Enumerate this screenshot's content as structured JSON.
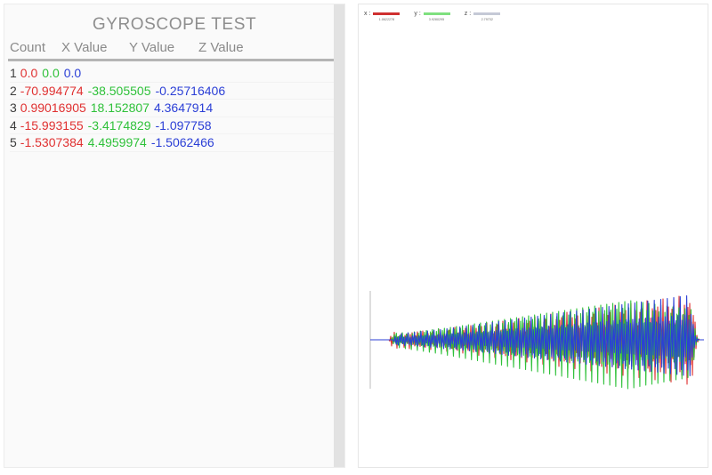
{
  "panel": {
    "title": "GYROSCOPE TEST",
    "columns": [
      "Count",
      "X Value",
      "Y Value",
      "Z Value"
    ],
    "rows": [
      {
        "count": "1",
        "x": "0.0",
        "y": "0.0",
        "z": "0.0"
      },
      {
        "count": "2",
        "x": "-70.994774",
        "y": "-38.505505",
        "z": "-0.25716406"
      },
      {
        "count": "3",
        "x": "0.99016905",
        "y": "18.152807",
        "z": "4.3647914"
      },
      {
        "count": "4",
        "x": "-15.993155",
        "y": "-3.4174829",
        "z": "-1.097758"
      },
      {
        "count": "5",
        "x": "-1.5307384",
        "y": "4.4959974",
        "z": "-1.5062466"
      }
    ]
  },
  "colors": {
    "x_series": "#e03131",
    "y_series": "#2fc13a",
    "z_series": "#2b3fd6",
    "title_text": "#8e8e8e",
    "header_text": "#8a8a8a",
    "axis_line": "#c8c8c8",
    "panel_background": "#fafafa",
    "graph_background": "#ffffff"
  },
  "graph": {
    "legend": [
      {
        "key": "x :",
        "value": "1.0622278",
        "swatch": "#cf3030"
      },
      {
        "key": "y :",
        "value": "3.9280295",
        "swatch": "#7fe07f"
      },
      {
        "key": "z :",
        "value": "2.79732",
        "swatch": "#c5c9d6"
      }
    ]
  },
  "chart_data": {
    "type": "line",
    "title": "",
    "xlabel": "",
    "ylabel": "",
    "grid": false,
    "legend_position": "top-left",
    "baseline_y": 0,
    "x_range": [
      0,
      370
    ],
    "y_range": [
      -110,
      110
    ],
    "series": [
      {
        "name": "x",
        "color": "#e03131",
        "values": [
          0,
          0,
          0,
          0,
          0,
          0,
          0,
          0,
          0,
          0,
          0,
          0,
          0,
          0,
          0,
          0,
          0,
          0,
          0,
          0,
          0,
          0,
          -3,
          8,
          -14,
          6,
          -9,
          17,
          -6,
          11,
          -19,
          7,
          -12,
          9,
          -5,
          14,
          -8,
          6,
          -17,
          10,
          -7,
          13,
          -9,
          5,
          -20,
          12,
          -8,
          16,
          -11,
          7,
          -14,
          9,
          -6,
          18,
          -12,
          8,
          -15,
          11,
          -9,
          20,
          -13,
          7,
          -17,
          12,
          -8,
          14,
          -10,
          6,
          -22,
          15,
          -9,
          18,
          -12,
          8,
          -16,
          11,
          -7,
          24,
          -17,
          10,
          -20,
          13,
          -9,
          18,
          -12,
          8,
          -26,
          19,
          -11,
          22,
          -14,
          10,
          -20,
          14,
          -9,
          28,
          -20,
          12,
          -24,
          16,
          -11,
          22,
          -15,
          10,
          -30,
          21,
          -13,
          26,
          -17,
          12,
          -24,
          16,
          -11,
          32,
          -23,
          14,
          -28,
          18,
          -13,
          26,
          -18,
          12,
          -35,
          25,
          -15,
          30,
          -20,
          14,
          -28,
          19,
          -13,
          38,
          -27,
          17,
          -32,
          21,
          -15,
          30,
          -20,
          14,
          -40,
          29,
          -18,
          34,
          -23,
          16,
          -32,
          22,
          -15,
          42,
          -31,
          19,
          -36,
          24,
          -17,
          34,
          -23,
          16,
          -45,
          33,
          -20,
          38,
          -26,
          18,
          -36,
          25,
          -17,
          48,
          -35,
          22,
          -40,
          27,
          -19,
          38,
          -26,
          18,
          -50,
          37,
          -23,
          42,
          -29,
          20,
          -40,
          28,
          -19,
          52,
          -38,
          24,
          -44,
          30,
          -21,
          42,
          -29,
          20,
          -55,
          40,
          -25,
          46,
          -31,
          22,
          -44,
          30,
          -21,
          58,
          -42,
          26,
          -48,
          33,
          -23,
          46,
          -32,
          22,
          -60,
          44,
          -27,
          50,
          -34,
          24,
          -48,
          33,
          -23,
          62,
          -46,
          28,
          -52,
          36,
          -25,
          50,
          -34,
          24,
          -65,
          47,
          -29,
          54,
          -37,
          26,
          -52,
          36,
          -25,
          68,
          -50,
          31,
          -56,
          38,
          -27,
          54,
          -37,
          26,
          -70,
          51,
          -32,
          58,
          -40,
          28,
          -56,
          38,
          -27,
          72,
          -53,
          33,
          -60,
          41,
          -29,
          58,
          -40,
          28,
          -75,
          55,
          -34,
          62,
          -42,
          30,
          -60,
          41,
          -29,
          78,
          -57,
          35,
          -64,
          44,
          -31,
          62,
          -43,
          30,
          -80,
          58,
          -36,
          66,
          -45,
          32,
          -64,
          44,
          -31,
          82,
          -60,
          37,
          -68,
          47,
          -33,
          66,
          -45,
          32,
          -85,
          62,
          -38,
          70,
          -48,
          34,
          -68,
          47,
          -33,
          88,
          -64,
          40,
          -72,
          49,
          -35,
          70,
          -48,
          34,
          -90,
          66,
          -41,
          74,
          -51,
          36,
          -72,
          50,
          -35,
          92,
          -67,
          42,
          -76,
          52,
          -37,
          74,
          -51,
          36,
          -95,
          69,
          -43,
          78,
          -53,
          38,
          -76,
          52,
          -37,
          98,
          -72,
          44,
          -80,
          55,
          -39,
          78,
          -54,
          38,
          -100,
          73,
          -45,
          82,
          -56,
          40,
          -80,
          55,
          -39,
          40,
          -20,
          10,
          -5,
          2,
          0,
          0,
          0,
          0,
          0,
          0
        ]
      },
      {
        "name": "y",
        "color": "#2fc13a",
        "values": [
          0,
          0,
          0,
          0,
          0,
          0,
          0,
          0,
          0,
          0,
          0,
          0,
          0,
          0,
          0,
          0,
          0,
          0,
          0,
          0,
          0,
          0,
          5,
          -9,
          12,
          -6,
          15,
          -10,
          7,
          -18,
          11,
          -7,
          16,
          -9,
          6,
          -20,
          13,
          -8,
          15,
          -11,
          7,
          -22,
          14,
          -9,
          18,
          -12,
          8,
          -24,
          15,
          -10,
          20,
          -13,
          9,
          -26,
          17,
          -11,
          21,
          -14,
          9,
          -28,
          18,
          -12,
          23,
          -15,
          10,
          -30,
          19,
          -13,
          25,
          -16,
          11,
          -32,
          21,
          -14,
          26,
          -17,
          12,
          -35,
          22,
          -15,
          28,
          -19,
          13,
          -37,
          24,
          -16,
          30,
          -20,
          14,
          -40,
          26,
          -17,
          32,
          -21,
          15,
          -42,
          27,
          -18,
          34,
          -23,
          15,
          -45,
          29,
          -19,
          36,
          -24,
          16,
          -47,
          31,
          -20,
          38,
          -26,
          17,
          -50,
          32,
          -21,
          40,
          -27,
          18,
          -52,
          34,
          -22,
          42,
          -28,
          19,
          -55,
          36,
          -24,
          44,
          -30,
          20,
          -57,
          37,
          -25,
          46,
          -31,
          21,
          -60,
          39,
          -26,
          48,
          -33,
          22,
          -62,
          41,
          -27,
          50,
          -34,
          23,
          -65,
          42,
          -28,
          52,
          -35,
          24,
          -67,
          44,
          -29,
          54,
          -37,
          25,
          -70,
          46,
          -30,
          56,
          -38,
          26,
          -72,
          47,
          -31,
          58,
          -40,
          27,
          -75,
          49,
          -32,
          60,
          -41,
          28,
          -77,
          51,
          -33,
          62,
          -42,
          28,
          -80,
          52,
          -35,
          64,
          -44,
          29,
          -82,
          54,
          -36,
          66,
          -45,
          30,
          -85,
          56,
          -37,
          68,
          -47,
          31,
          -87,
          57,
          -38,
          70,
          -48,
          32,
          -90,
          59,
          -39,
          72,
          -49,
          33,
          -92,
          61,
          -40,
          74,
          -51,
          34,
          -95,
          62,
          -41,
          76,
          -52,
          35,
          -97,
          64,
          -42,
          78,
          -54,
          36,
          -100,
          66,
          -43,
          80,
          -55,
          37,
          -102,
          67,
          -44,
          82,
          -56,
          38,
          -105,
          69,
          -46,
          84,
          -58,
          39,
          -107,
          71,
          -47,
          86,
          -59,
          40,
          -110,
          72,
          -48,
          88,
          -60,
          41,
          -108,
          70,
          -46,
          86,
          -58,
          40,
          -105,
          68,
          -45,
          84,
          -57,
          39,
          -102,
          66,
          -44,
          82,
          -55,
          38,
          -100,
          65,
          -43,
          80,
          -54,
          37,
          -98,
          63,
          -42,
          78,
          -53,
          36,
          -95,
          62,
          -41,
          76,
          -52,
          35,
          -92,
          60,
          -40,
          74,
          -50,
          34,
          -90,
          58,
          -38,
          72,
          -49,
          33,
          -88,
          57,
          -37,
          70,
          -48,
          32,
          -85,
          55,
          -36,
          68,
          -46,
          31,
          -45,
          25,
          -12,
          6,
          -2,
          0,
          0,
          0,
          0,
          0,
          0
        ]
      },
      {
        "name": "z",
        "color": "#2b3fd6",
        "values": [
          0,
          0,
          0,
          0,
          0,
          0,
          0,
          0,
          0,
          0,
          0,
          0,
          0,
          0,
          0,
          0,
          0,
          0,
          0,
          0,
          0,
          0,
          -4,
          7,
          -10,
          5,
          -12,
          8,
          -5,
          14,
          -9,
          6,
          -13,
          7,
          -5,
          16,
          -10,
          6,
          -12,
          9,
          -6,
          17,
          -11,
          7,
          -14,
          9,
          -6,
          19,
          -12,
          8,
          -16,
          10,
          -7,
          20,
          -13,
          9,
          -17,
          11,
          -7,
          22,
          -14,
          9,
          -18,
          12,
          -8,
          23,
          -15,
          10,
          -20,
          13,
          -9,
          25,
          -16,
          11,
          -21,
          14,
          -9,
          27,
          -17,
          12,
          -22,
          15,
          -10,
          29,
          -19,
          12,
          -24,
          16,
          -11,
          31,
          -20,
          13,
          -25,
          17,
          -12,
          33,
          -21,
          14,
          -27,
          18,
          -12,
          35,
          -23,
          15,
          -28,
          19,
          -13,
          37,
          -24,
          16,
          -30,
          20,
          -14,
          39,
          -25,
          17,
          -31,
          21,
          -14,
          41,
          -27,
          18,
          -33,
          23,
          -15,
          43,
          -28,
          19,
          -35,
          24,
          -16,
          45,
          -30,
          20,
          -36,
          25,
          -17,
          47,
          -31,
          21,
          -38,
          26,
          -17,
          49,
          -32,
          22,
          -40,
          27,
          -18,
          51,
          -34,
          23,
          -41,
          28,
          -19,
          53,
          -35,
          24,
          -43,
          29,
          -20,
          55,
          -36,
          24,
          -45,
          31,
          -21,
          57,
          -38,
          25,
          -46,
          32,
          -22,
          59,
          -39,
          26,
          -48,
          33,
          -23,
          61,
          -41,
          27,
          -50,
          34,
          -23,
          63,
          -42,
          28,
          -51,
          35,
          -24,
          65,
          -43,
          29,
          -53,
          37,
          -25,
          67,
          -45,
          30,
          -55,
          38,
          -26,
          69,
          -46,
          31,
          -56,
          39,
          -27,
          71,
          -48,
          32,
          -58,
          40,
          -27,
          73,
          -49,
          33,
          -60,
          41,
          -28,
          75,
          -50,
          34,
          -61,
          43,
          -29,
          77,
          -52,
          35,
          -63,
          44,
          -30,
          79,
          -53,
          36,
          -65,
          45,
          -31,
          81,
          -55,
          37,
          -66,
          46,
          -32,
          83,
          -56,
          37,
          -68,
          47,
          -32,
          85,
          -58,
          38,
          -70,
          49,
          -33,
          87,
          -59,
          39,
          -71,
          50,
          -34,
          89,
          -61,
          40,
          -73,
          51,
          -35,
          91,
          -62,
          41,
          -75,
          52,
          -36,
          93,
          -64,
          42,
          -76,
          53,
          -37,
          95,
          -65,
          43,
          -78,
          55,
          -38,
          97,
          -67,
          44,
          -80,
          56,
          -39,
          99,
          -68,
          45,
          -81,
          57,
          -39,
          35,
          -18,
          9,
          -4,
          2,
          0,
          0,
          0,
          0,
          0,
          0
        ]
      }
    ]
  }
}
